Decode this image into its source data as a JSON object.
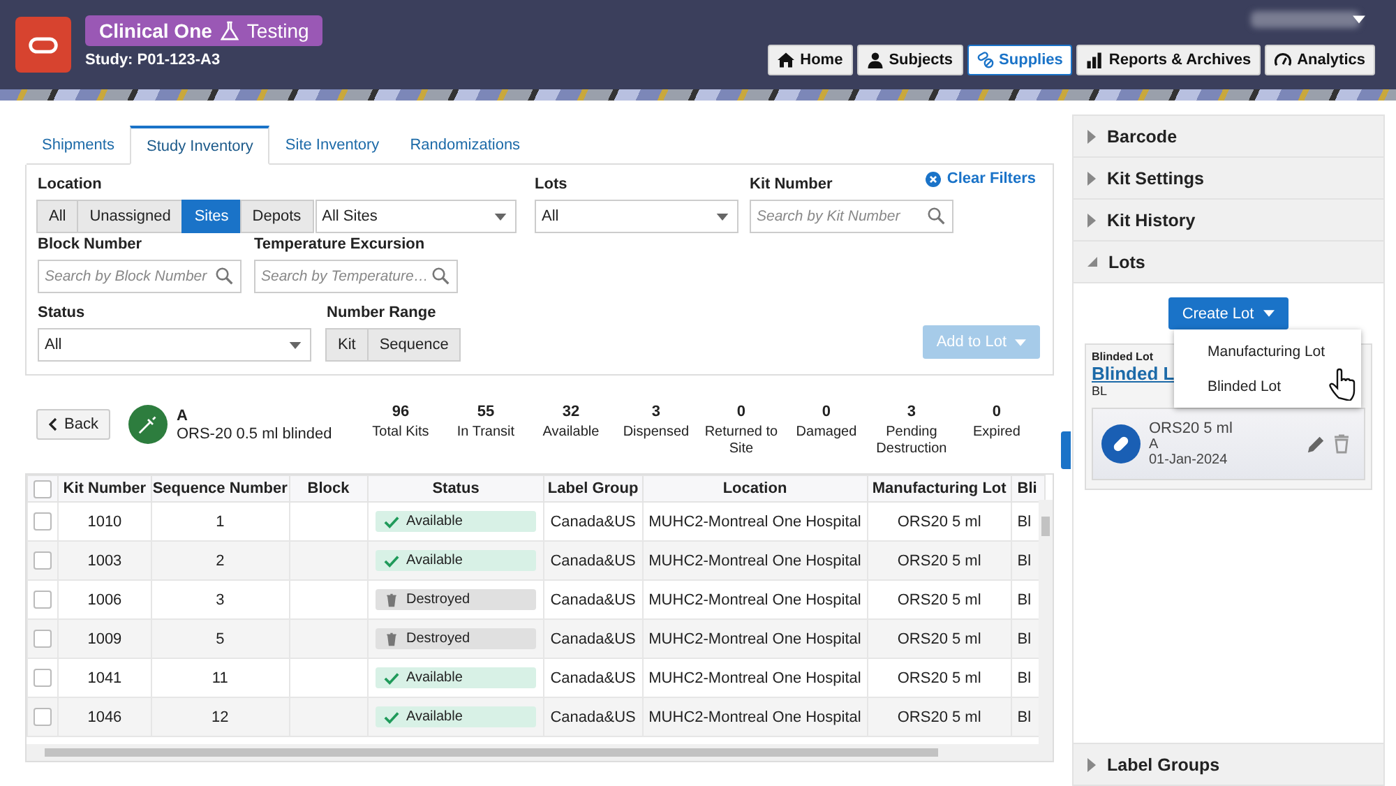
{
  "header": {
    "app_name": "Clinical One",
    "mode": "Testing",
    "study": "Study: P01-123-A3",
    "nav": [
      {
        "label": "Home",
        "selected": false
      },
      {
        "label": "Subjects",
        "selected": false
      },
      {
        "label": "Supplies",
        "selected": true
      },
      {
        "label": "Reports & Archives",
        "selected": false
      },
      {
        "label": "Analytics",
        "selected": false
      }
    ]
  },
  "tabs": [
    {
      "label": "Shipments",
      "selected": false
    },
    {
      "label": "Study Inventory",
      "selected": true
    },
    {
      "label": "Site Inventory",
      "selected": false
    },
    {
      "label": "Randomizations",
      "selected": false
    }
  ],
  "filters": {
    "location": {
      "label": "Location",
      "segments": [
        {
          "label": "All",
          "selected": false
        },
        {
          "label": "Unassigned",
          "selected": false
        },
        {
          "label": "Sites",
          "selected": true
        },
        {
          "label": "Depots",
          "selected": false
        }
      ],
      "value": "All Sites"
    },
    "lots": {
      "label": "Lots",
      "value": "All"
    },
    "kit_number": {
      "label": "Kit Number",
      "placeholder": "Search by Kit Number"
    },
    "clear_filters": "Clear Filters",
    "block_number": {
      "label": "Block Number",
      "placeholder": "Search by Block Number"
    },
    "temperature_excursion": {
      "label": "Temperature Excursion",
      "placeholder": "Search by Temperature…"
    },
    "status": {
      "label": "Status",
      "value": "All"
    },
    "number_range": {
      "label": "Number Range",
      "segments": [
        {
          "label": "Kit",
          "selected": false
        },
        {
          "label": "Sequence",
          "selected": false
        }
      ]
    },
    "add_to_lot": {
      "label": "Add to Lot",
      "disabled": true
    }
  },
  "summary": {
    "back": "Back",
    "item_code": "A",
    "item_name": "ORS-20 0.5 ml blinded",
    "stats": [
      {
        "value": "96",
        "label": "Total Kits"
      },
      {
        "value": "55",
        "label": "In Transit"
      },
      {
        "value": "32",
        "label": "Available"
      },
      {
        "value": "3",
        "label": "Dispensed"
      },
      {
        "value": "0",
        "label": "Returned to Site"
      },
      {
        "value": "0",
        "label": "Damaged"
      },
      {
        "value": "3",
        "label": "Pending Destruction"
      },
      {
        "value": "0",
        "label": "Expired"
      }
    ]
  },
  "table": {
    "all_checked": false,
    "columns": [
      "Kit Number",
      "Sequence Number",
      "Block",
      "Status",
      "Label Group",
      "Location",
      "Manufacturing Lot",
      "Bli"
    ],
    "rows": [
      {
        "checked": false,
        "cells": [
          "1010",
          "1",
          "",
          "Available",
          "Canada&US",
          "MUHC2-Montreal One Hospital",
          "ORS20 5 ml",
          "Bl"
        ],
        "kind": "available"
      },
      {
        "checked": false,
        "cells": [
          "1003",
          "2",
          "",
          "Available",
          "Canada&US",
          "MUHC2-Montreal One Hospital",
          "ORS20 5 ml",
          "Bl"
        ],
        "kind": "available"
      },
      {
        "checked": false,
        "cells": [
          "1006",
          "3",
          "",
          "Destroyed",
          "Canada&US",
          "MUHC2-Montreal One Hospital",
          "ORS20 5 ml",
          "Bl"
        ],
        "kind": "destroyed"
      },
      {
        "checked": false,
        "cells": [
          "1009",
          "5",
          "",
          "Destroyed",
          "Canada&US",
          "MUHC2-Montreal One Hospital",
          "ORS20 5 ml",
          "Bl"
        ],
        "kind": "destroyed"
      },
      {
        "checked": false,
        "cells": [
          "1041",
          "11",
          "",
          "Available",
          "Canada&US",
          "MUHC2-Montreal One Hospital",
          "ORS20 5 ml",
          "Bl"
        ],
        "kind": "available"
      },
      {
        "checked": false,
        "cells": [
          "1046",
          "12",
          "",
          "Available",
          "Canada&US",
          "MUHC2-Montreal One Hospital",
          "ORS20 5 ml",
          "Bl"
        ],
        "kind": "available"
      }
    ]
  },
  "side": {
    "sections": [
      {
        "label": "Barcode",
        "expanded": false
      },
      {
        "label": "Kit Settings",
        "expanded": false
      },
      {
        "label": "Kit History",
        "expanded": false
      },
      {
        "label": "Lots",
        "expanded": true
      },
      {
        "label": "Label Groups",
        "expanded": false
      }
    ],
    "create_lot": "Create Lot",
    "menu": [
      "Manufacturing Lot",
      "Blinded Lot"
    ],
    "lot": {
      "type": "Blinded Lot",
      "name": "Blinded L",
      "code": "BL",
      "item": {
        "name": "ORS20 5 ml",
        "code": "A",
        "date": "01-Jan-2024"
      }
    }
  }
}
